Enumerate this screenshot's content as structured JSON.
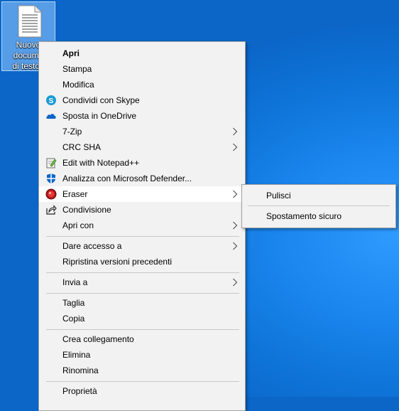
{
  "desktop": {
    "file_icon_label": "Nuovo documento di testo.txt",
    "file_icon_label_lines": "Nuovo\ndocume\ndi testo.."
  },
  "context_menu": {
    "items": [
      {
        "label": "Apri",
        "bold": true,
        "icon": "none"
      },
      {
        "label": "Stampa",
        "icon": "none"
      },
      {
        "label": "Modifica",
        "icon": "none"
      },
      {
        "label": "Condividi con Skype",
        "icon": "skype-icon"
      },
      {
        "label": "Sposta in OneDrive",
        "icon": "onedrive-icon"
      },
      {
        "label": "7-Zip",
        "icon": "none",
        "submenu": true
      },
      {
        "label": "CRC SHA",
        "icon": "none",
        "submenu": true
      },
      {
        "label": "Edit with Notepad++",
        "icon": "notepadpp-icon"
      },
      {
        "label": "Analizza con Microsoft Defender...",
        "icon": "defender-icon"
      },
      {
        "label": "Eraser",
        "icon": "eraser-icon",
        "submenu": true,
        "highlighted": true
      },
      {
        "label": "Condivisione",
        "icon": "share-icon"
      },
      {
        "label": "Apri con",
        "icon": "none",
        "submenu": true
      },
      {
        "label": "Dare accesso a",
        "icon": "none",
        "submenu": true
      },
      {
        "label": "Ripristina versioni precedenti",
        "icon": "none"
      },
      {
        "label": "Invia a",
        "icon": "none",
        "submenu": true
      },
      {
        "label": "Taglia",
        "icon": "none"
      },
      {
        "label": "Copia",
        "icon": "none"
      },
      {
        "label": "Crea collegamento",
        "icon": "none"
      },
      {
        "label": "Elimina",
        "icon": "none"
      },
      {
        "label": "Rinomina",
        "icon": "none"
      },
      {
        "label": "Proprietà",
        "icon": "none"
      }
    ]
  },
  "eraser_submenu": {
    "items": [
      {
        "label": "Pulisci"
      },
      {
        "label": "Spostamento sicuro"
      }
    ]
  },
  "colors": {
    "menu_background": "#f2f2f2",
    "highlight": "#ffffff",
    "desktop_blue": "#0f75d9"
  }
}
